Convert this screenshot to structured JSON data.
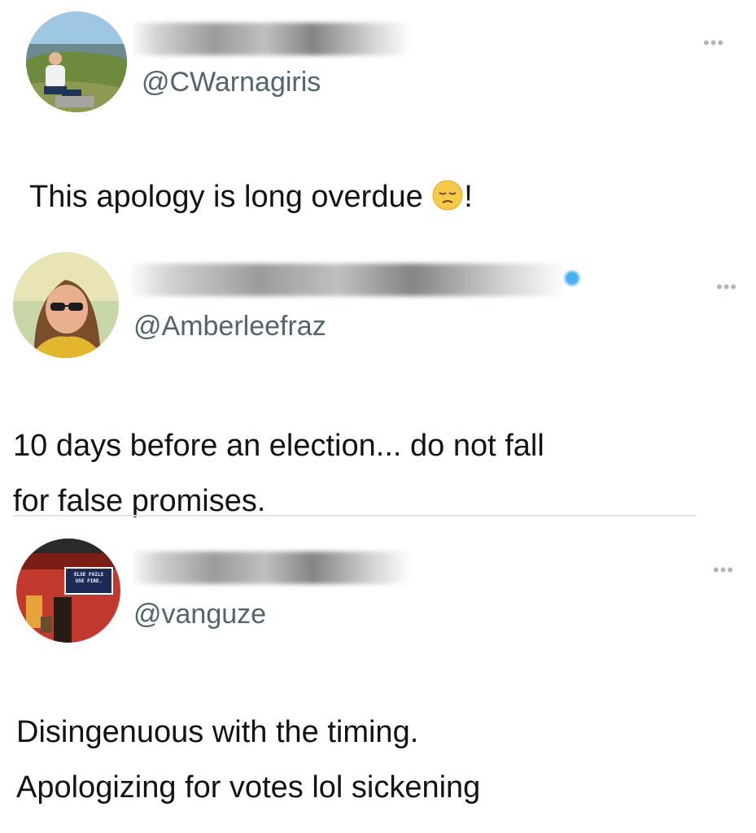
{
  "tweets": [
    {
      "handle": "@CWarnagiris",
      "more_label": "•••",
      "text_before_emoji": "This apology is long overdue ",
      "emoji": "pensive-face",
      "text_after_emoji": "!"
    },
    {
      "handle": "@Amberleefraz",
      "more_label": "•••",
      "text_line1": "10 days before an election... do not fall",
      "text_line2": "for false promises."
    },
    {
      "handle": "@vanguze",
      "more_label": "•••",
      "avatar_sign_line1": "ELSE FAILS",
      "avatar_sign_line2": "USE FIRE.",
      "text_line1": "Disingenuous with the timing.",
      "text_line2": "Apologizing for votes lol sickening"
    }
  ],
  "colors": {
    "text": "#0f1419",
    "handle": "#536471",
    "verified": "#1d9bf0",
    "background": "#ffffff"
  }
}
